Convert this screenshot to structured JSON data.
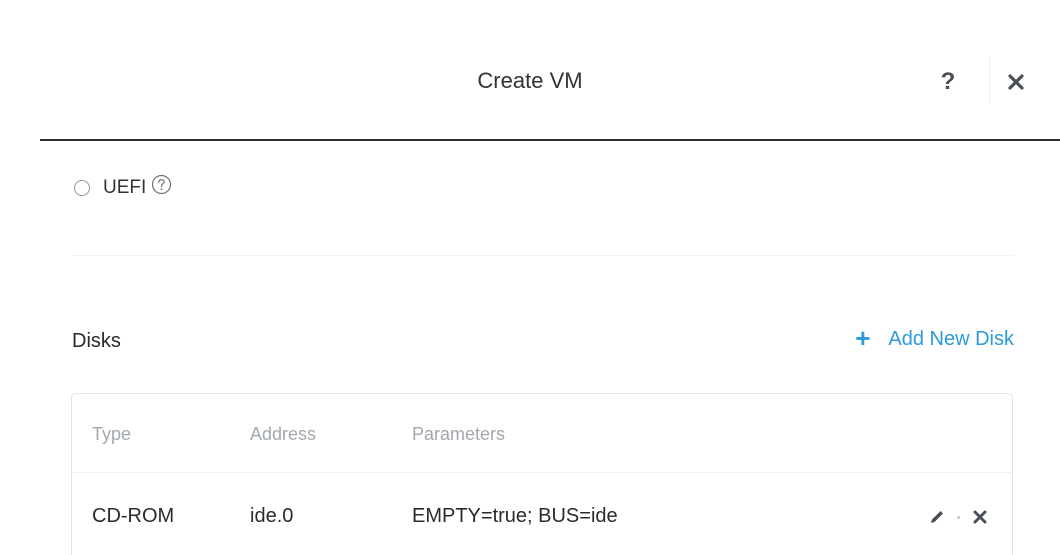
{
  "dialog": {
    "title": "Create VM",
    "help_label": "?",
    "close_icon": "close-icon"
  },
  "boot": {
    "option_label": "UEFI",
    "selected": false,
    "info_icon": "info-icon"
  },
  "disks": {
    "section_title": "Disks",
    "add_button_label": "Add New Disk",
    "add_button_icon": "plus-icon",
    "columns": [
      "Type",
      "Address",
      "Parameters"
    ],
    "rows": [
      {
        "type": "CD-ROM",
        "address": "ide.0",
        "parameters": "EMPTY=true; BUS=ide",
        "actions": [
          "pencil-icon",
          "close-icon"
        ]
      }
    ]
  },
  "colors": {
    "accent": "#2b9bdb",
    "header_rule": "#2c2c2c",
    "muted_text": "#a3a8af",
    "icon_gray": "#4a4f57"
  }
}
